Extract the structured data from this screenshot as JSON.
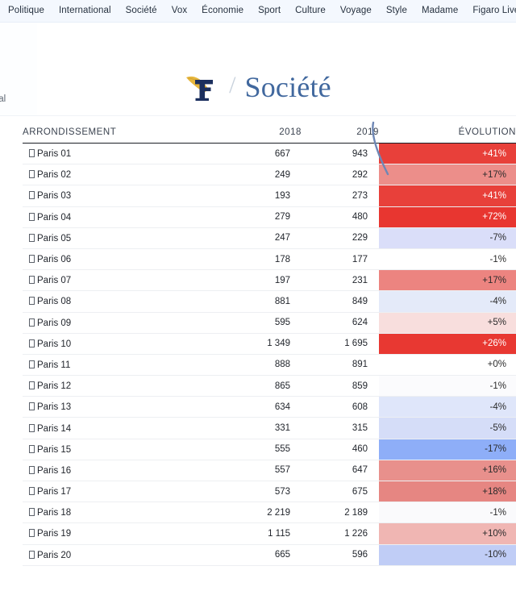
{
  "nav": {
    "items": [
      {
        "label": "Politique"
      },
      {
        "label": "International"
      },
      {
        "label": "Société"
      },
      {
        "label": "Vox"
      },
      {
        "label": "Économie"
      },
      {
        "label": "Sport"
      },
      {
        "label": "Culture"
      },
      {
        "label": "Voyage"
      },
      {
        "label": "Style"
      },
      {
        "label": "Madame"
      },
      {
        "label": "Figaro Live"
      }
    ],
    "plus_icon": "circle-plus-icon"
  },
  "header": {
    "breadcrumb_partial": "rnal",
    "logo_icon": "figaro-f-quill-logo",
    "separator": "/",
    "section_title": "Société",
    "brand_navy": "#1b2f5e",
    "brand_gold": "#e7b63c",
    "title_blue": "#41689e"
  },
  "chart_data": {
    "type": "table",
    "title": "",
    "columns": [
      "ARRONDISSEMENT",
      "2018",
      "2019",
      "ÉVOLUTION"
    ],
    "categories": [
      "Paris 01",
      "Paris 02",
      "Paris 03",
      "Paris 04",
      "Paris 05",
      "Paris 06",
      "Paris 07",
      "Paris 08",
      "Paris 09",
      "Paris 10",
      "Paris 11",
      "Paris 12",
      "Paris 13",
      "Paris 14",
      "Paris 15",
      "Paris 16",
      "Paris 17",
      "Paris 18",
      "Paris 19",
      "Paris 20"
    ],
    "series": [
      {
        "name": "2018",
        "values": [
          667,
          249,
          193,
          279,
          247,
          178,
          197,
          881,
          595,
          1349,
          888,
          865,
          634,
          331,
          555,
          557,
          573,
          2219,
          1115,
          665
        ]
      },
      {
        "name": "2019",
        "values": [
          943,
          292,
          273,
          480,
          229,
          177,
          231,
          849,
          624,
          1695,
          891,
          859,
          608,
          315,
          460,
          647,
          675,
          2189,
          1226,
          596
        ]
      },
      {
        "name": "ÉVOLUTION",
        "values": [
          41,
          17,
          41,
          72,
          -7,
          -1,
          17,
          -4,
          5,
          26,
          0,
          -1,
          -4,
          -5,
          -17,
          16,
          18,
          -1,
          10,
          -10
        ]
      }
    ],
    "rows": [
      {
        "arrondissement": "Paris 01",
        "v2018": "667",
        "v2019": "943",
        "evolution": "+41%",
        "fill": "#e8403a",
        "text_color": "#ffffff"
      },
      {
        "arrondissement": "Paris 02",
        "v2018": "249",
        "v2019": "292",
        "evolution": "+17%",
        "fill": "#ec8e8a",
        "text_color": "#2b2b2b"
      },
      {
        "arrondissement": "Paris 03",
        "v2018": "193",
        "v2019": "273",
        "evolution": "+41%",
        "fill": "#e8403a",
        "text_color": "#ffffff"
      },
      {
        "arrondissement": "Paris 04",
        "v2018": "279",
        "v2019": "480",
        "evolution": "+72%",
        "fill": "#e83630",
        "text_color": "#ffffff"
      },
      {
        "arrondissement": "Paris 05",
        "v2018": "247",
        "v2019": "229",
        "evolution": "-7%",
        "fill": "#dadef9",
        "text_color": "#2b2b2b"
      },
      {
        "arrondissement": "Paris 06",
        "v2018": "178",
        "v2019": "177",
        "evolution": "-1%",
        "fill": "#ffffff",
        "text_color": "#2b2b2b"
      },
      {
        "arrondissement": "Paris 07",
        "v2018": "197",
        "v2019": "231",
        "evolution": "+17%",
        "fill": "#ec8480",
        "text_color": "#2b2b2b"
      },
      {
        "arrondissement": "Paris 08",
        "v2018": "881",
        "v2019": "849",
        "evolution": "-4%",
        "fill": "#e4eaf9",
        "text_color": "#2b2b2b"
      },
      {
        "arrondissement": "Paris 09",
        "v2018": "595",
        "v2019": "624",
        "evolution": "+5%",
        "fill": "#f8dedd",
        "text_color": "#2b2b2b"
      },
      {
        "arrondissement": "Paris 10",
        "v2018": "1 349",
        "v2019": "1 695",
        "evolution": "+26%",
        "fill": "#e83832",
        "text_color": "#ffffff"
      },
      {
        "arrondissement": "Paris 11",
        "v2018": "888",
        "v2019": "891",
        "evolution": "+0%",
        "fill": "#ffffff",
        "text_color": "#2b2b2b"
      },
      {
        "arrondissement": "Paris 12",
        "v2018": "865",
        "v2019": "859",
        "evolution": "-1%",
        "fill": "#fbfbfd",
        "text_color": "#2b2b2b"
      },
      {
        "arrondissement": "Paris 13",
        "v2018": "634",
        "v2019": "608",
        "evolution": "-4%",
        "fill": "#dfe6fa",
        "text_color": "#2b2b2b"
      },
      {
        "arrondissement": "Paris 14",
        "v2018": "331",
        "v2019": "315",
        "evolution": "-5%",
        "fill": "#d5ddf8",
        "text_color": "#2b2b2b"
      },
      {
        "arrondissement": "Paris 15",
        "v2018": "555",
        "v2019": "460",
        "evolution": "-17%",
        "fill": "#8eaef8",
        "text_color": "#2b2b2b"
      },
      {
        "arrondissement": "Paris 16",
        "v2018": "557",
        "v2019": "647",
        "evolution": "+16%",
        "fill": "#e8908c",
        "text_color": "#2b2b2b"
      },
      {
        "arrondissement": "Paris 17",
        "v2018": "573",
        "v2019": "675",
        "evolution": "+18%",
        "fill": "#e68682",
        "text_color": "#2b2b2b"
      },
      {
        "arrondissement": "Paris 18",
        "v2018": "2 219",
        "v2019": "2 189",
        "evolution": "-1%",
        "fill": "#fafafc",
        "text_color": "#2b2b2b"
      },
      {
        "arrondissement": "Paris 19",
        "v2018": "1 115",
        "v2019": "1 226",
        "evolution": "+10%",
        "fill": "#f0b6b3",
        "text_color": "#2b2b2b"
      },
      {
        "arrondissement": "Paris 20",
        "v2018": "665",
        "v2019": "596",
        "evolution": "-10%",
        "fill": "#c0cdf6",
        "text_color": "#2b2b2b"
      }
    ],
    "legend": [],
    "grid": false,
    "colors": {
      "positive_strong": "#e8403a",
      "positive_weak": "#f8dedd",
      "negative_strong": "#8eaef8",
      "negative_weak": "#e4eaf9",
      "neutral": "#ffffff"
    }
  },
  "decor": {
    "curve_color": "#6e87b5"
  }
}
